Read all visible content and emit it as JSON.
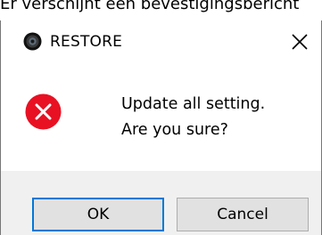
{
  "background_caption": "Er verschijnt een bevestigingsbericht",
  "dialog": {
    "title": "RESTORE",
    "icons": {
      "app": "record-disc-icon",
      "close": "close-icon",
      "status": "error-icon"
    },
    "message_lines": [
      "Update all setting.",
      "Are you sure?"
    ],
    "buttons": {
      "ok": "OK",
      "cancel": "Cancel"
    }
  },
  "colors": {
    "error": "#e81123",
    "focus_border": "#0078d7",
    "footer_bg": "#f0f0f0"
  }
}
